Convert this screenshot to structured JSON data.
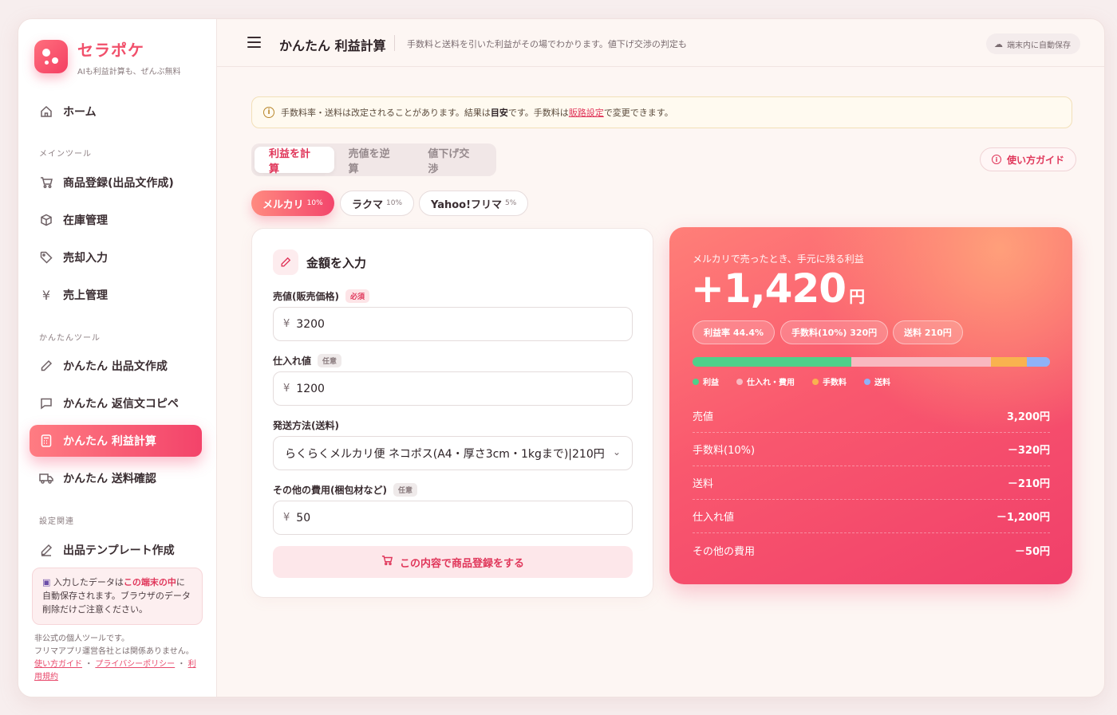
{
  "brand": {
    "name": "セラポケ",
    "tagline": "AIも利益計算も、ぜんぶ無料"
  },
  "sidebar": {
    "home": "ホーム",
    "sections": [
      "メインツール",
      "かんたんツール",
      "設定関連"
    ],
    "main_tools": [
      "商品登録(出品文作成)",
      "在庫管理",
      "売却入力",
      "売上管理"
    ],
    "easy_tools": [
      "かんたん 出品文作成",
      "かんたん 返信文コピペ",
      "かんたん 利益計算",
      "かんたん 送料確認"
    ],
    "settings": [
      "出品テンプレート作成"
    ],
    "info": {
      "pre": "入力したデータは",
      "highlight": "この端末の中",
      "post": "に自動保存されます。ブラウザのデータ削除だけご注意ください。"
    },
    "footer": {
      "line1": "非公式の個人ツールです。",
      "line2": "フリマアプリ運営各社とは関係ありません。",
      "links": [
        "使い方ガイド",
        "プライバシーポリシー",
        "利用規約"
      ],
      "separator": "・"
    }
  },
  "header": {
    "title": "かんたん 利益計算",
    "subtitle": "手数料と送料を引いた利益がその場でわかります。値下げ交渉の判定も",
    "autosave": "端末内に自動保存"
  },
  "notice": {
    "pre": "手数料率・送料は改定されることがあります。結果は",
    "bold": "目安",
    "mid": "です。手数料は",
    "link": "販路設定",
    "post": "で変更できます。"
  },
  "tabs": [
    "利益を計算",
    "売値を逆算",
    "値下げ交渉"
  ],
  "guide_label": "使い方ガイド",
  "platforms": [
    {
      "name": "メルカリ",
      "rate": "10%"
    },
    {
      "name": "ラクマ",
      "rate": "10%"
    },
    {
      "name": "Yahoo!フリマ",
      "rate": "5%"
    }
  ],
  "form": {
    "title": "金額を入力",
    "price_label": "売値(販売価格)",
    "required_tag": "必須",
    "optional_tag": "任意",
    "yen": "¥",
    "price_value": "3200",
    "cost_label": "仕入れ値",
    "cost_value": "1200",
    "shipping_label": "発送方法(送料)",
    "shipping_value": "らくらくメルカリ便 ネコポス(A4・厚さ3cm・1kgまで)|210円",
    "other_label": "その他の費用(梱包材など)",
    "other_value": "50",
    "register_button": "この内容で商品登録をする"
  },
  "result": {
    "caption": "メルカリで売ったとき、手元に残る利益",
    "profit": "+1,420",
    "unit": "円",
    "chips": [
      "利益率 44.4%",
      "手数料(10%) 320円",
      "送料 210円"
    ],
    "breakdown": [
      {
        "label": "利益",
        "value": 1420,
        "color": "#4fd08a"
      },
      {
        "label": "仕入れ・費用",
        "value": 1250,
        "color": "#f9b8c0"
      },
      {
        "label": "手数料",
        "value": 320,
        "color": "#f9b24f"
      },
      {
        "label": "送料",
        "value": 210,
        "color": "#8fb2f7"
      }
    ],
    "rows": [
      {
        "label": "売値",
        "value": "3,200円"
      },
      {
        "label": "手数料(10%)",
        "value": "－320円"
      },
      {
        "label": "送料",
        "value": "－210円"
      },
      {
        "label": "仕入れ値",
        "value": "－1,200円"
      },
      {
        "label": "その他の費用",
        "value": "－50円"
      }
    ]
  }
}
